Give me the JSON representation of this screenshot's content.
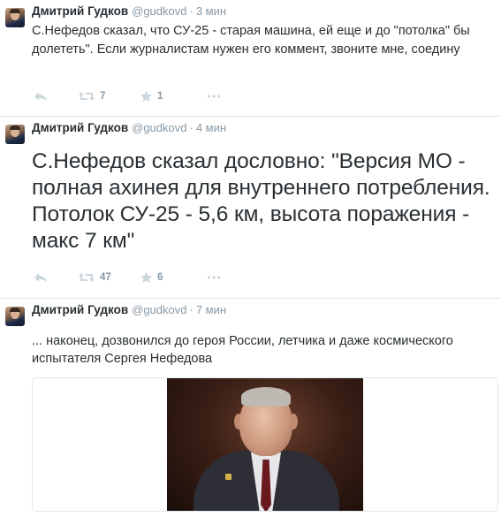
{
  "tweets": [
    {
      "author_name": "Дмитрий Гудков",
      "handle": "@gudkovd",
      "separator": "·",
      "time": "3 мин",
      "text": "С.Нефедов сказал, что СУ-25 - старая машина, ей еще и до \"потолка\" бы долететь\". Если журналистам нужен его коммент, звоните мне, соедину",
      "retweets": "7",
      "favorites": "1"
    },
    {
      "author_name": "Дмитрий Гудков",
      "handle": "@gudkovd",
      "separator": "·",
      "time": "4 мин",
      "text": "С.Нефедов сказал дословно: \"Версия МО - полная ахинея для внутреннего потребления. Потолок СУ-25 - 5,6 км, высота поражения - макс 7 км\"",
      "retweets": "47",
      "favorites": "6"
    },
    {
      "author_name": "Дмитрий Гудков",
      "handle": "@gudkovd",
      "separator": "·",
      "time": "7 мин",
      "text": "... наконец, дозвонился до героя России, летчика и даже космического испытателя Сергея Нефедова"
    }
  ],
  "icons": {
    "reply": "reply-arrow-icon",
    "retweet": "retweet-icon",
    "favorite": "star-icon",
    "more": "ellipsis-icon"
  },
  "colors": {
    "text": "#292f33",
    "muted": "#8899a6",
    "icon": "#ccd6dd",
    "divider": "#e1e8ed"
  }
}
